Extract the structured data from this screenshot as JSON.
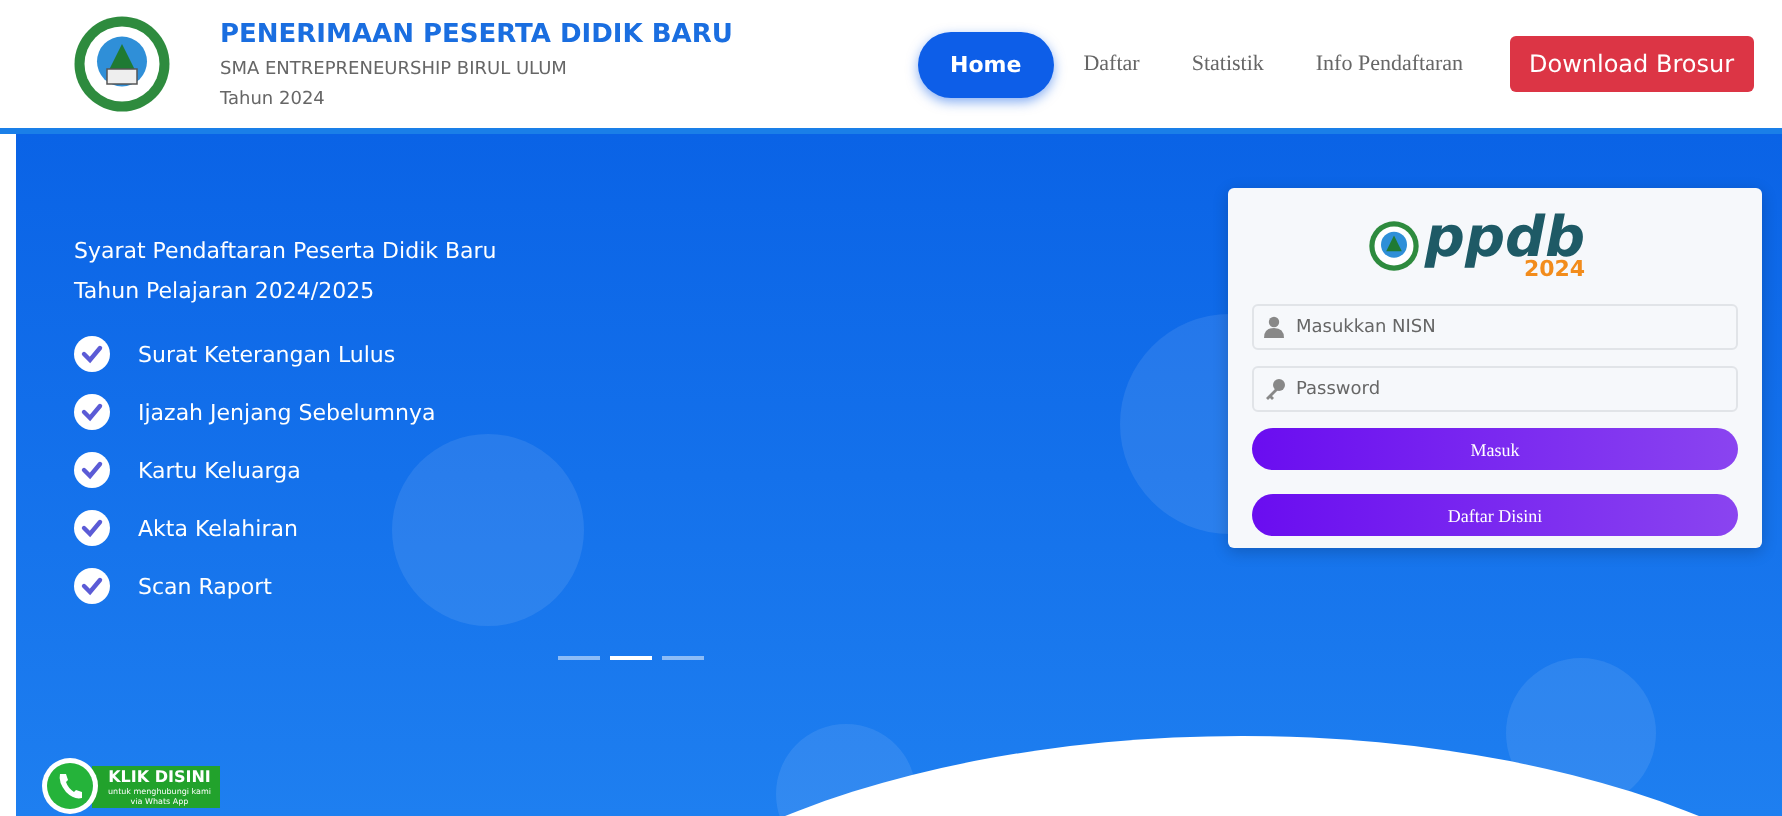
{
  "header": {
    "title": "PENERIMAAN PESERTA DIDIK BARU",
    "school": "SMA ENTREPRENEURSHIP BIRUL ULUM",
    "year": "Tahun 2024"
  },
  "nav": [
    {
      "label": "Home",
      "selected": true
    },
    {
      "label": "Daftar",
      "selected": false
    },
    {
      "label": "Statistik",
      "selected": false
    },
    {
      "label": "Info Pendaftaran",
      "selected": false
    }
  ],
  "download_button": "Download Brosur",
  "hero": {
    "heading": [
      "Syarat Pendaftaran Peserta Didik Baru",
      "Tahun Pelajaran 2024/2025"
    ],
    "requirements": [
      {
        "label": "Surat Keterangan Lulus",
        "checked": true
      },
      {
        "label": "Ijazah Jenjang Sebelumnya",
        "checked": true
      },
      {
        "label": "Kartu Keluarga",
        "checked": true
      },
      {
        "label": "Akta Kelahiran",
        "checked": true
      },
      {
        "label": "Scan Raport",
        "checked": true
      }
    ],
    "slides": [
      {
        "selected": false
      },
      {
        "selected": true
      },
      {
        "selected": false
      }
    ]
  },
  "login": {
    "logo_text": "ppdb",
    "logo_year": "2024",
    "nisn_placeholder": "Masukkan NISN",
    "password_placeholder": "Password",
    "login_button": "Masuk",
    "register_button": "Daftar Disini"
  },
  "whatsapp": {
    "title": "KLIK DISINI",
    "line_1": "untuk menghubungi kami",
    "line_2": "via Whats App"
  }
}
